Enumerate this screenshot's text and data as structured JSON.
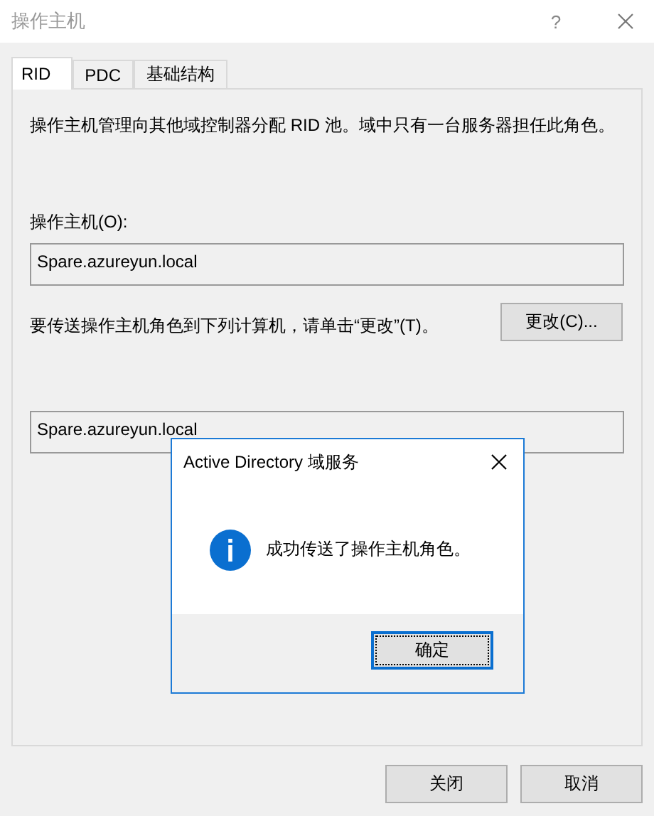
{
  "window": {
    "title": "操作主机",
    "help": "?"
  },
  "tabs": [
    {
      "label": "RID",
      "selected": true
    },
    {
      "label": "PDC",
      "selected": false
    },
    {
      "label": "基础结构",
      "selected": false
    }
  ],
  "panel": {
    "description": "操作主机管理向其他域控制器分配 RID 池。域中只有一台服务器担任此角色。",
    "master_label": "操作主机(O):",
    "master_value": "Spare.azureyun.local",
    "transfer_text": "要传送操作主机角色到下列计算机，请单击“更改”(T)。",
    "change_button": "更改(C)...",
    "target_value": "Spare.azureyun.local"
  },
  "buttons": [
    {
      "label": "关闭"
    },
    {
      "label": "取消"
    }
  ],
  "message_box": {
    "title": "Active Directory 域服务",
    "message": "成功传送了操作主机角色。",
    "button": "确定"
  }
}
